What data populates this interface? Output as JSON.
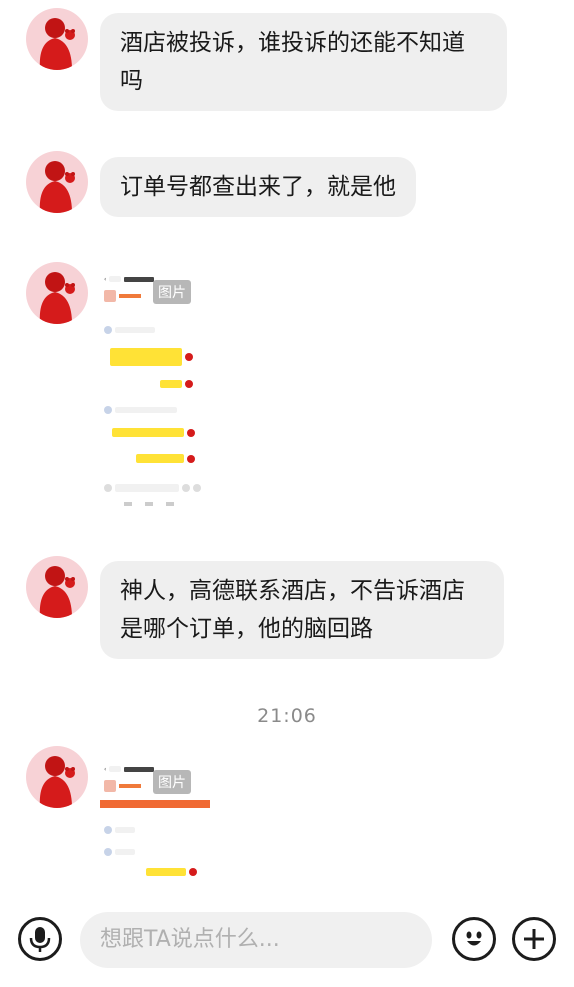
{
  "messages": [
    {
      "type": "text",
      "text": "酒店被投诉，谁投诉的还能不知道吗"
    },
    {
      "type": "text",
      "text": "订单号都查出来了，就是他"
    },
    {
      "type": "image",
      "badge": "图片"
    },
    {
      "type": "text",
      "text": "神人，高德联系酒店，不告诉酒店是哪个订单，他的脑回路"
    },
    {
      "type": "image",
      "badge": "图片"
    }
  ],
  "time_divider": "21:06",
  "input": {
    "placeholder": "想跟TA说点什么..."
  },
  "icons": {
    "voice": "microphone-icon",
    "emoji": "emoji-icon",
    "add": "plus-icon"
  },
  "colors": {
    "bubble": "#efefef",
    "avatar_bg": "#f7d2d6",
    "avatar_figure": "#d51b1b",
    "mini_yellow": "#ffe236"
  }
}
